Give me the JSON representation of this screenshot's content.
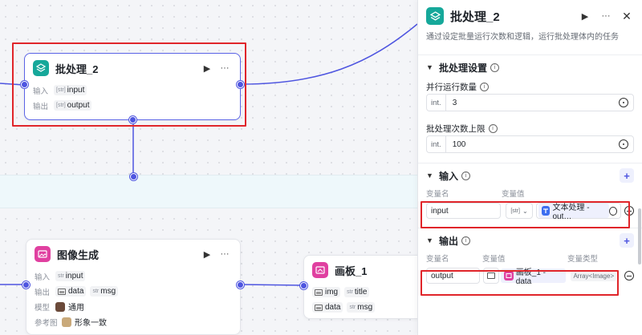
{
  "canvas": {
    "batch_node": {
      "title": "批处理_2",
      "input_label": "输入",
      "input_value": "input",
      "output_label": "输出",
      "output_value": "output",
      "list_badge": "[str]"
    },
    "image_node": {
      "title": "图像生成",
      "input_label": "输入",
      "input_type": "str",
      "input_value": "input",
      "output_label": "输出",
      "output_img": "data",
      "output_str_type": "str",
      "output_str": "msg",
      "model_label": "模型",
      "model_value": "通用",
      "ref_label": "参考图",
      "ref_value": "形象一致"
    },
    "board_node": {
      "title": "画板_1",
      "row1_img": "img",
      "row1_str_type": "str",
      "row1_str": "title",
      "row2_img": "data",
      "row2_str_type": "str",
      "row2_str": "msg"
    }
  },
  "panel": {
    "title": "批处理_2",
    "description": "通过设定批量运行次数和逻辑，运行批处理体内的任务",
    "settings": {
      "heading": "批处理设置",
      "parallel_label": "并行运行数量",
      "parallel_type": "int.",
      "parallel_value": "3",
      "limit_label": "批处理次数上限",
      "limit_type": "int.",
      "limit_value": "100"
    },
    "input": {
      "heading": "输入",
      "col_name": "变量名",
      "col_value": "变量值",
      "name": "input",
      "type_badge": "[str]",
      "ref": "文本处理 - out…"
    },
    "output": {
      "heading": "输出",
      "col_name": "变量名",
      "col_value": "变量值",
      "col_type": "变量类型",
      "name": "output",
      "ref": "画板_1 - data",
      "type": "Array<Image>"
    }
  },
  "colors": {
    "accent": "#4e55e0",
    "highlight": "#e0252a",
    "batch_icon": "#16a89a",
    "image_icon": "#e040a0"
  }
}
